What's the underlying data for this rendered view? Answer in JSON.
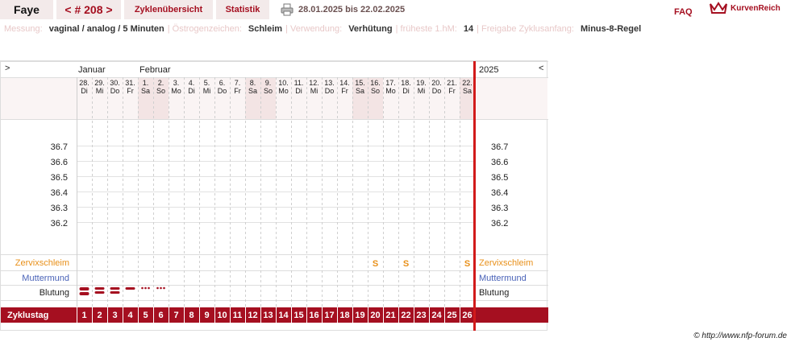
{
  "header": {
    "name": "Faye",
    "prev": "<",
    "cycle_number": "# 208",
    "next": ">",
    "tab_overview": "Zyklenübersicht",
    "tab_stats": "Statistik",
    "date_range": "28.01.2025 bis 22.02.2025",
    "faq": "FAQ",
    "logo_text": "KurvenReich"
  },
  "info": [
    {
      "label": "Messung:",
      "value": "vaginal / analog / 5 Minuten"
    },
    {
      "label": "Östrogenzeichen:",
      "value": "Schleim"
    },
    {
      "label": "Verwendung:",
      "value": "Verhütung"
    },
    {
      "label": "früheste 1.hM:",
      "value": "14"
    },
    {
      "label": "Freigabe Zyklusanfang:",
      "value": "Minus-8-Regel"
    }
  ],
  "chart": {
    "scroll_left": ">",
    "scroll_right": "<",
    "year": "2025",
    "months": [
      {
        "label": "Januar",
        "col": 0
      },
      {
        "label": "Februar",
        "col": 4
      }
    ],
    "dates": [
      "28.",
      "29.",
      "30.",
      "31.",
      "1.",
      "2.",
      "3.",
      "4.",
      "5.",
      "6.",
      "7.",
      "8.",
      "9.",
      "10.",
      "11.",
      "12.",
      "13.",
      "14.",
      "15.",
      "16.",
      "17.",
      "18.",
      "19.",
      "20.",
      "21.",
      "22."
    ],
    "weekdays": [
      "Di",
      "Mi",
      "Do",
      "Fr",
      "Sa",
      "So",
      "Mo",
      "Di",
      "Mi",
      "Do",
      "Fr",
      "Sa",
      "So",
      "Mo",
      "Di",
      "Mi",
      "Do",
      "Fr",
      "Sa",
      "So",
      "Mo",
      "Di",
      "Mi",
      "Do",
      "Fr",
      "Sa"
    ],
    "weekend_cols": [
      4,
      5,
      11,
      12,
      18,
      19,
      25
    ],
    "temp_labels": [
      "36.7",
      "36.6",
      "36.5",
      "36.4",
      "36.3",
      "36.2"
    ],
    "row_cervix": "Zervixschleim",
    "row_mm": "Muttermund",
    "row_bleed": "Blutung",
    "row_cycleday": "Zyklustag",
    "cervix_marks": [
      {
        "col": 19,
        "mark": "S"
      },
      {
        "col": 21,
        "mark": "S"
      },
      {
        "col": 25,
        "mark": "S"
      }
    ],
    "bleeding": [
      {
        "col": 0,
        "type": "heavy"
      },
      {
        "col": 1,
        "type": "medium"
      },
      {
        "col": 2,
        "type": "medium"
      },
      {
        "col": 3,
        "type": "light"
      },
      {
        "col": 4,
        "type": "spotting"
      },
      {
        "col": 5,
        "type": "spotting"
      }
    ],
    "cycle_days": [
      "1",
      "2",
      "3",
      "4",
      "5",
      "6",
      "7",
      "8",
      "9",
      "10",
      "11",
      "12",
      "13",
      "14",
      "15",
      "16",
      "17",
      "18",
      "19",
      "20",
      "21",
      "22",
      "23",
      "24",
      "25",
      "26"
    ],
    "colors": {
      "accent": "#a50f20",
      "weekend": "#f3e4e4",
      "cervix": "#e8901a",
      "muttermund": "#4a63b8",
      "grid": "#cfcfcf",
      "bg_light": "#faf4f4"
    }
  },
  "footer": "© http://www.nfp-forum.de"
}
